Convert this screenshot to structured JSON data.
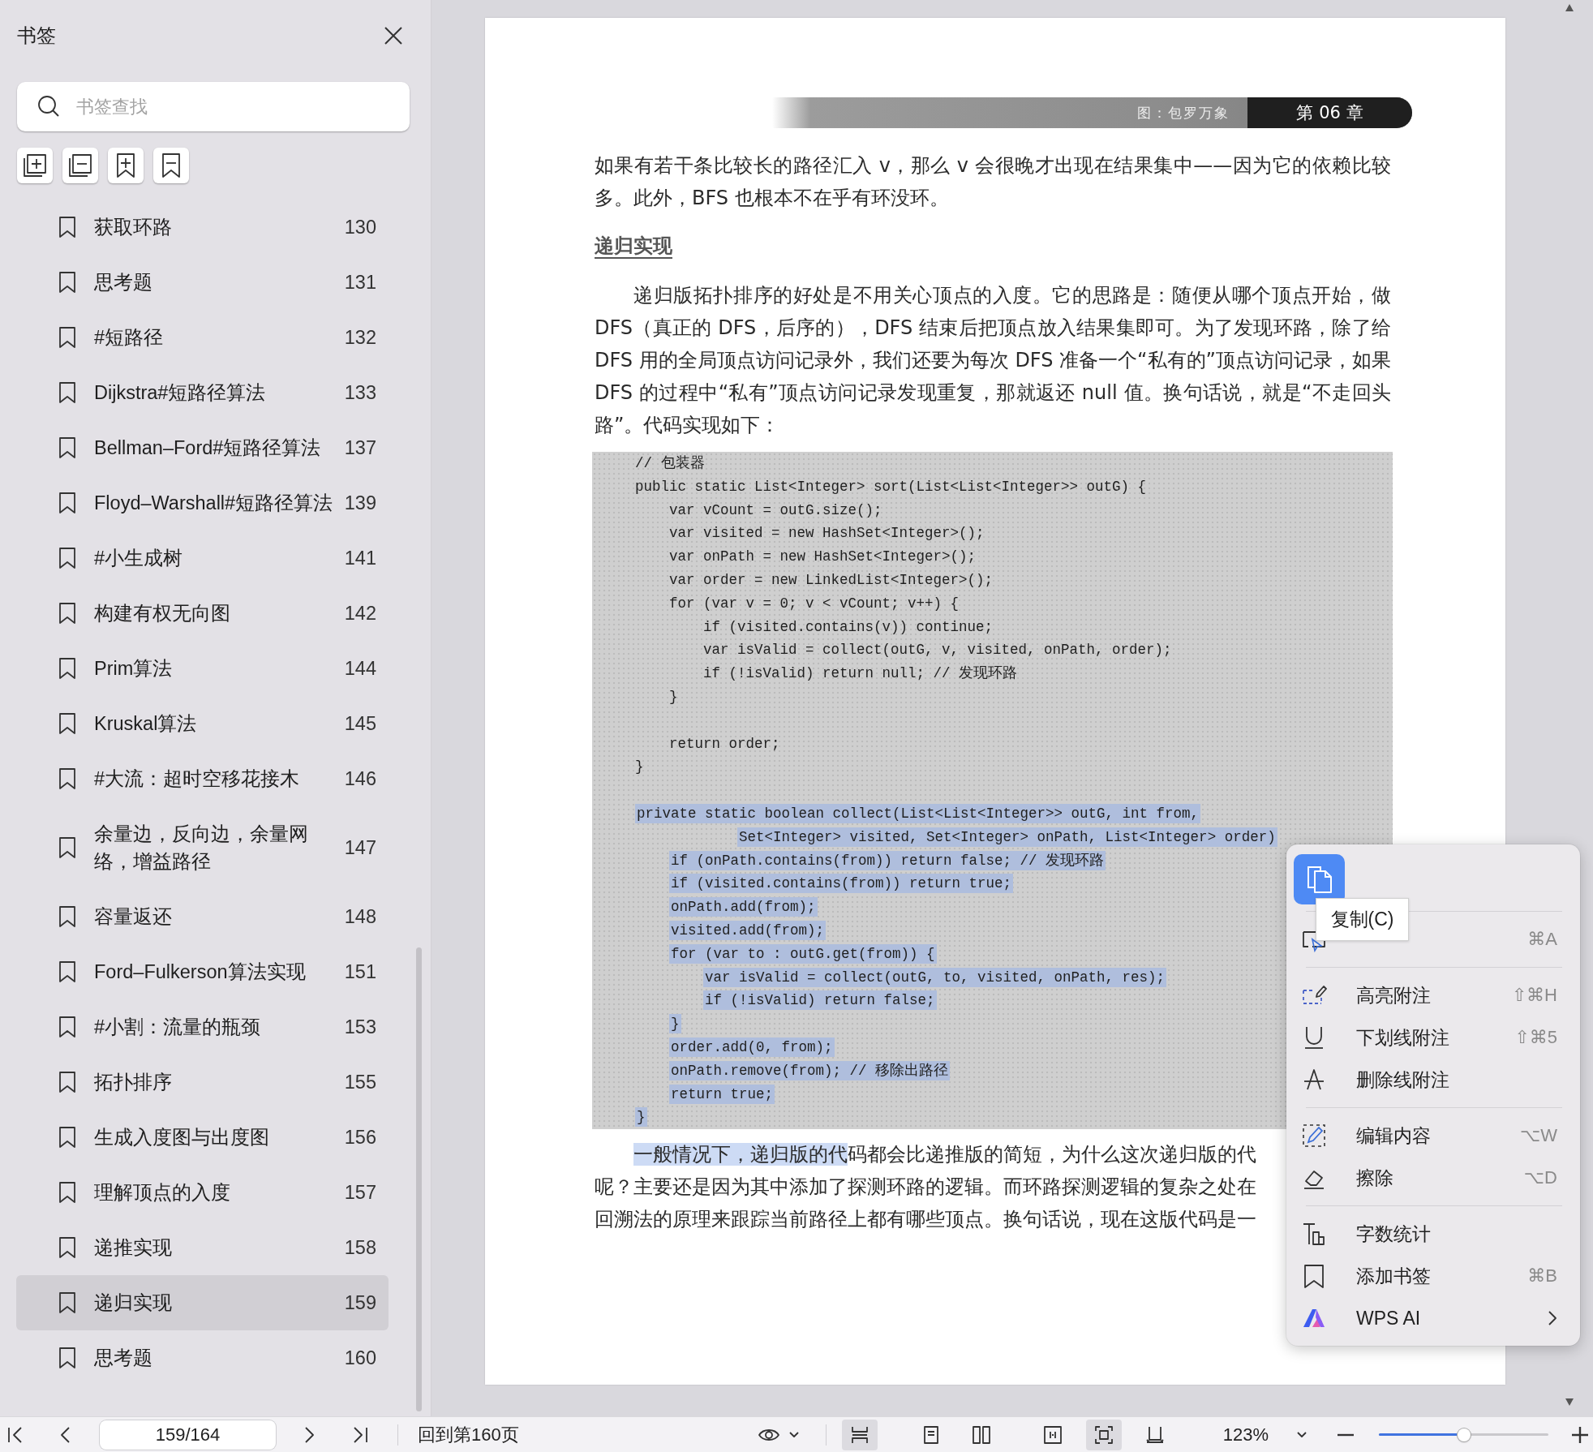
{
  "sidebar": {
    "title": "书签",
    "search": {
      "placeholder": "书签查找"
    },
    "bookmarks": [
      {
        "title": "获取环路",
        "page": "130",
        "selected": false
      },
      {
        "title": "思考题",
        "page": "131",
        "selected": false
      },
      {
        "title": "#短路径",
        "page": "132",
        "selected": false
      },
      {
        "title": "Dijkstra#短路径算法",
        "page": "133",
        "selected": false
      },
      {
        "title": "Bellman–Ford#短路径算法",
        "page": "137",
        "selected": false
      },
      {
        "title": "Floyd–Warshall#短路径算法",
        "page": "139",
        "selected": false
      },
      {
        "title": "#小生成树",
        "page": "141",
        "selected": false
      },
      {
        "title": "构建有权无向图",
        "page": "142",
        "selected": false
      },
      {
        "title": "Prim算法",
        "page": "144",
        "selected": false
      },
      {
        "title": "Kruskal算法",
        "page": "145",
        "selected": false
      },
      {
        "title": "#大流：超时空移花接木",
        "page": "146",
        "selected": false
      },
      {
        "title": "余量边，反向边，余量网络，增益路径",
        "page": "147",
        "selected": false
      },
      {
        "title": "容量返还",
        "page": "148",
        "selected": false
      },
      {
        "title": "Ford–Fulkerson算法实现",
        "page": "151",
        "selected": false
      },
      {
        "title": "#小割：流量的瓶颈",
        "page": "153",
        "selected": false
      },
      {
        "title": "拓扑排序",
        "page": "155",
        "selected": false
      },
      {
        "title": "生成入度图与出度图",
        "page": "156",
        "selected": false
      },
      {
        "title": "理解顶点的入度",
        "page": "157",
        "selected": false
      },
      {
        "title": "递推实现",
        "page": "158",
        "selected": false
      },
      {
        "title": "递归实现",
        "page": "159",
        "selected": true
      },
      {
        "title": "思考题",
        "page": "160",
        "selected": false
      }
    ]
  },
  "page": {
    "banner": {
      "caption": "图：包罗万象",
      "chapter": "第 06 章"
    },
    "blocks": [
      {
        "kind": "paragraph",
        "indent": false,
        "text": "如果有若干条比较长的路径汇入 v，那么 v 会很晚才出现在结果集中——因为它的依赖比较多。此外，BFS 也根本不在乎有环没环。"
      },
      {
        "kind": "heading",
        "text": "递归实现"
      },
      {
        "kind": "paragraph",
        "indent": true,
        "text": "递归版拓扑排序的好处是不用关心顶点的入度。它的思路是：随便从哪个顶点开始，做 DFS（真正的 DFS，后序的），DFS 结束后把顶点放入结果集即可。为了发现环路，除了给 DFS 用的全局顶点访问记录外，我们还要为每次 DFS 准备一个“私有的”顶点访问记录，如果 DFS 的过程中“私有”顶点访问记录发现重复，那就返还 null 值。换句话说，就是“不走回头路”。代码实现如下："
      },
      {
        "kind": "code",
        "sections": [
          {
            "lines": [
              {
                "text": "// 包装器",
                "selected": false
              },
              {
                "text": "public static List<Integer> sort(List<List<Integer>> outG) {",
                "selected": false
              },
              {
                "text": "    var vCount = outG.size();",
                "selected": false
              },
              {
                "text": "    var visited = new HashSet<Integer>();",
                "selected": false
              },
              {
                "text": "    var onPath = new HashSet<Integer>();",
                "selected": false
              },
              {
                "text": "    var order = new LinkedList<Integer>();",
                "selected": false
              },
              {
                "text": "    for (var v = 0; v < vCount; v++) {",
                "selected": false
              },
              {
                "text": "        if (visited.contains(v)) continue;",
                "selected": false
              },
              {
                "text": "        var isValid = collect(outG, v, visited, onPath, order);",
                "selected": false
              },
              {
                "text": "        if (!isValid) return null; // 发现环路",
                "selected": false
              },
              {
                "text": "    }",
                "selected": false
              }
            ]
          },
          {
            "lines": [
              {
                "text": "    return order;",
                "selected": false
              },
              {
                "text": "}",
                "selected": false
              }
            ]
          },
          {
            "lines": [
              {
                "text": "private static boolean collect(List<List<Integer>> outG, int from,",
                "selected": true
              },
              {
                "text": "            Set<Integer> visited, Set<Integer> onPath, List<Integer> order)",
                "selected": true
              },
              {
                "text": "    if (onPath.contains(from)) return false; // 发现环路",
                "selected": true
              },
              {
                "text": "    if (visited.contains(from)) return true;",
                "selected": true
              },
              {
                "text": "    onPath.add(from);",
                "selected": true
              },
              {
                "text": "    visited.add(from);",
                "selected": true
              },
              {
                "text": "    for (var to : outG.get(from)) {",
                "selected": true
              },
              {
                "text": "        var isValid = collect(outG, to, visited, onPath, res);",
                "selected": true
              },
              {
                "text": "        if (!isValid) return false;",
                "selected": true
              },
              {
                "text": "    }",
                "selected": true
              },
              {
                "text": "    order.add(0, from);",
                "selected": true
              },
              {
                "text": "    onPath.remove(from); // 移除出路径",
                "selected": true
              },
              {
                "text": "    return true;",
                "selected": true
              },
              {
                "text": "}",
                "selected": true
              }
            ]
          }
        ]
      },
      {
        "kind": "lines",
        "lines": [
          {
            "indent": true,
            "segments": [
              {
                "text": "一般情况下，递归版的代",
                "selected": true
              },
              {
                "text": "码都会比递推版的简短，为什么这次递归版的代",
                "selected": false
              }
            ]
          },
          {
            "indent": false,
            "segments": [
              {
                "text": "呢？主要还是因为其中添加了探测环路的逻辑。而环路探测逻辑的复杂之处在",
                "selected": false
              }
            ]
          },
          {
            "indent": false,
            "segments": [
              {
                "text": "回溯法的原理来跟踪当前路径上都有哪些顶点。换句话说，现在这版代码是一",
                "selected": false
              }
            ]
          }
        ]
      }
    ]
  },
  "context_menu": {
    "copy_tooltip": "复制(C)",
    "groups": [
      [
        {
          "shortcut": "⌘A"
        }
      ],
      [
        {
          "label": "高亮附注",
          "shortcut": "⇧⌘H",
          "submenu": false
        },
        {
          "label": "下划线附注",
          "shortcut": "⇧⌘5",
          "submenu": false
        },
        {
          "label": "删除线附注",
          "submenu": false
        }
      ],
      [
        {
          "label": "编辑内容",
          "shortcut": "⌥W",
          "submenu": false
        },
        {
          "label": "擦除",
          "shortcut": "⌥D",
          "submenu": false
        }
      ],
      [
        {
          "label": "字数统计",
          "submenu": false
        },
        {
          "label": "添加书签",
          "shortcut": "⌘B",
          "submenu": false
        },
        {
          "label": "WPS AI",
          "submenu": true
        }
      ]
    ]
  },
  "status_bar": {
    "page_field": {
      "value": "159/164"
    },
    "goto_link": "回到第160页",
    "view_buttons": [
      {
        "selected": true
      },
      {
        "selected": false
      },
      {
        "selected": false
      },
      {
        "selected": false
      },
      {
        "selected": true
      },
      {
        "selected": false
      }
    ],
    "zoom": {
      "value": "123%"
    },
    "zoom_slider": {
      "level": 0.5
    }
  }
}
